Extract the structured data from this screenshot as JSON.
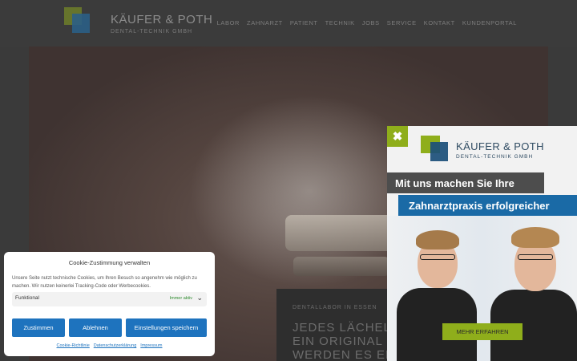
{
  "header": {
    "logo_name": "KÄUFER & POTH",
    "logo_sub": "DENTAL-TECHNIK GMBH",
    "nav": [
      "LABOR",
      "ZAHNARZT",
      "PATIENT",
      "TECHNIK",
      "JOBS",
      "SERVICE",
      "KONTAKT",
      "KUNDENPORTAL"
    ]
  },
  "hero": {
    "kicker": "DENTALLABOR IN ESSEN",
    "lines": [
      "JEDES LÄCHELI",
      "EIN ORIGINAL -",
      "WERDEN ES ER"
    ]
  },
  "cookie": {
    "title": "Cookie-Zustimmung verwalten",
    "text": "Unsere Seite nutzt technische Cookies, um Ihren Besuch so angenehm wie möglich zu machen. Wir nutzen keinerlei Tracking-Code oder Werbecookies.",
    "category_label": "Funktional",
    "category_status": "Immer aktiv",
    "accept": "Zustimmen",
    "deny": "Ablehnen",
    "save": "Einstellungen speichern",
    "links": [
      "Cookie-Richtlinie",
      "Datenschutzerklärung",
      "Impressum"
    ]
  },
  "popup": {
    "close": "✖",
    "logo_name": "KÄUFER & POTH",
    "logo_sub": "DENTAL-TECHNIK GMBH",
    "headline1": "Mit uns machen Sie Ihre",
    "headline2": "Zahnarztpraxis erfolgreicher",
    "cta": "MEHR ERFAHREN"
  },
  "colors": {
    "accent_green": "#8fae1b",
    "accent_blue": "#1a6aa6",
    "button_blue": "#1e73be"
  }
}
